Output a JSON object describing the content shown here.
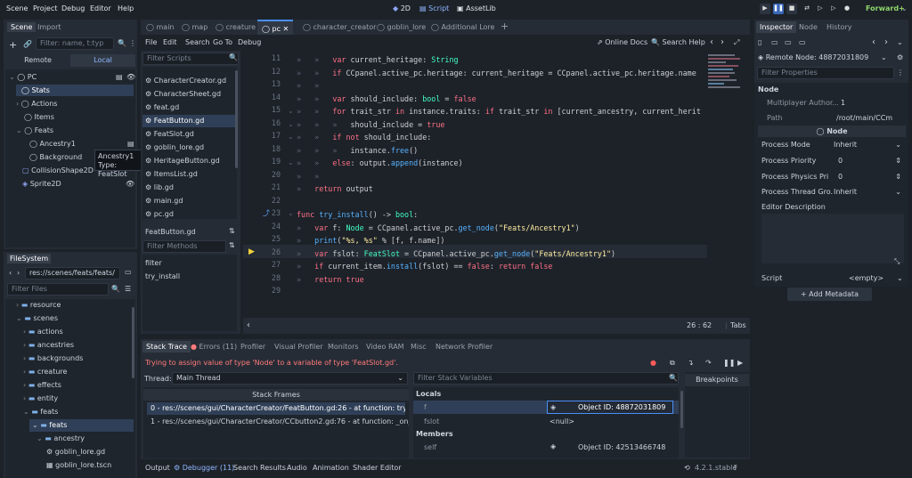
{
  "menu": {
    "items": [
      "Scene",
      "Project",
      "Debug",
      "Editor",
      "Help"
    ],
    "workspaces": [
      "2D",
      "Script",
      "AssetLib"
    ],
    "renderer": "Forward+"
  },
  "scene_panel": {
    "tabs": [
      "Scene",
      "Import"
    ],
    "filter_placeholder": "Filter: name, t:typ",
    "remote": "Remote",
    "local": "Local",
    "tree": [
      "PC",
      "Stats",
      "Actions",
      "Items",
      "Feats",
      "Ancestry1",
      "Background",
      "CollisionShape2D",
      "Sprite2D"
    ],
    "tooltip_line1": "Ancestry1",
    "tooltip_line2": "Type: FeatSlot"
  },
  "filesystem": {
    "title": "FileSystem",
    "path": "res://scenes/feats/feats/",
    "filter": "Filter Files",
    "items": [
      "resource",
      "scenes",
      "actions",
      "ancestries",
      "backgrounds",
      "creature",
      "effects",
      "entity",
      "feats",
      "feats",
      "ancestry",
      "goblin_lore.gd",
      "goblin_lore.tscn"
    ]
  },
  "script_tabs": [
    "main",
    "map",
    "creature",
    "pc",
    "character_creator",
    "goblin_lore",
    "Additional Lore"
  ],
  "script_menu": {
    "items": [
      "File",
      "Edit",
      "Search",
      "Go To",
      "Debug"
    ],
    "online_docs": "Online Docs",
    "search_help": "Search Help"
  },
  "script_list": {
    "filter": "Filter Scripts",
    "items": [
      "CharacterCreator.gd",
      "CharacterSheet.gd",
      "feat.gd",
      "FeatButton.gd",
      "FeatSlot.gd",
      "goblin_lore.gd",
      "HeritageButton.gd",
      "ItemsList.gd",
      "lib.gd",
      "main.gd",
      "pc.gd"
    ],
    "current": "FeatButton.gd",
    "methods_filter": "Filter Methods",
    "methods": [
      "filter",
      "try_install"
    ]
  },
  "editor": {
    "lines": [
      "11",
      "12",
      "13",
      "14",
      "15",
      "16",
      "17",
      "18",
      "19",
      "20",
      "21",
      "22",
      "23",
      "24",
      "25",
      "26",
      "27",
      "28",
      "29"
    ],
    "cursor": "26 :   62",
    "indent": "Tabs",
    "code": {
      "l11a": "var",
      "l11b": " current_heritage: ",
      "l11c": "String",
      "l12a": "if",
      "l12b": " CCpanel.active_pc.heritage: current_heritage = CCpanel.active_pc.heritage.name",
      "l14a": "var",
      "l14b": " should_include: ",
      "l14c": "bool",
      "l14d": " = ",
      "l14e": "false",
      "l15a": "for",
      "l15b": " trait_str ",
      "l15c": "in",
      "l15d": " instance.traits: ",
      "l15e": "if",
      "l15f": " trait_str ",
      "l15g": "in",
      "l15h": " [current_ancestry, current_herit",
      "l16a": "should_include = ",
      "l16b": "true",
      "l17a": "if",
      "l17b": " ",
      "l17c": "not",
      "l17d": " should_include:",
      "l18a": "instance.",
      "l18b": "free",
      "l18c": "()",
      "l19a": "else",
      ": ": "",
      "l19b": ": output.",
      "l19c": "append",
      "l19d": "(instance)",
      "l21a": "return",
      "l21b": " output",
      "l23a": "func",
      "l23b": " ",
      "l23c": "try_install",
      "l23d": "() -> ",
      "l23e": "bool",
      ":": ":",
      "l24a": "var",
      "l24b": " f: ",
      "l24c": "Node",
      "l24d": " = CCpanel.active_pc.",
      "l24e": "get_node",
      "l24f": "(",
      "l24g": "\"Feats/Ancestry1\"",
      "l24h": ")",
      "l25a": "print",
      "l25b": "(",
      "l25c": "\"%s, %s\"",
      "l25d": " % [f, f.name])",
      "l26a": "var",
      "l26b": " fslot: ",
      "l26c": "FeatSlot",
      "l26d": " = CCpanel.active_pc.",
      "l26e": "get_node",
      "l26f": "(",
      "l26g": "\"Feats/Ancestry1\"",
      "l26h": ")",
      "l27a": "if",
      "l27b": " current_item.",
      "l27c": "install",
      "l27d": "(fslot) == ",
      "l27e": "false",
      ": return ": ": ",
      "l27f": "return",
      "l27g": " ",
      "l27h": "false",
      "l28a": "return",
      "l28b": " ",
      "l28c": "true"
    }
  },
  "debugger": {
    "tabs": [
      "Stack Trace",
      "Errors (11)",
      "Profiler",
      "Visual Profiler",
      "Monitors",
      "Video RAM",
      "Misc",
      "Network Profiler"
    ],
    "error": "Trying to assign value of type 'Node' to a variable of type 'FeatSlot.gd'.",
    "thread_label": "Thread:",
    "thread_value": "Main Thread",
    "stack_header": "Stack Frames",
    "frames": [
      "0 - res://scenes/gui/CharacterCreator/FeatButton.gd:26 - at function: try_install",
      "1 - res://scenes/gui/CharacterCreator/CCbutton2.gd:76 - at function: _on_confirm"
    ],
    "filter_vars": "Filter Stack Variables",
    "locals": "Locals",
    "members": "Members",
    "vars": [
      {
        "name": "f",
        "value": "Object ID: 48872031809"
      },
      {
        "name": "fslot",
        "value": "<null>"
      },
      {
        "name": "self",
        "value": "Object ID: 42513466748"
      }
    ],
    "breakpoints": "Breakpoints"
  },
  "bottom_tabs": [
    "Output",
    "Debugger (11)",
    "Search Results",
    "Audio",
    "Animation",
    "Shader Editor"
  ],
  "version": "4.2.1.stable",
  "inspector": {
    "tabs": [
      "Inspector",
      "Node",
      "History"
    ],
    "remote_node": "Remote Node: 48872031809",
    "filter": "Filter Properties",
    "section": "Node",
    "props": [
      {
        "name": "Multiplayer Author...",
        "value": "1"
      },
      {
        "name": "Path",
        "value": "/root/main/CCm"
      }
    ],
    "node_header": "Node",
    "props2": [
      {
        "name": "Process Mode",
        "value": "Inherit"
      },
      {
        "name": "Process Priority",
        "value": "0"
      },
      {
        "name": "Process Physics Pri...",
        "value": "0"
      },
      {
        "name": "Process Thread Gro...",
        "value": "Inherit"
      },
      {
        "name": "Editor Description",
        "value": ""
      }
    ],
    "script_label": "Script",
    "script_value": "<empty>",
    "add_metadata": "Add Metadata"
  },
  "colors": {
    "accent": "#4a8ff7",
    "bg": "#1d2229",
    "panel": "#262c35",
    "error_text": "#ff7b7b",
    "keyword": "#ff7085",
    "type": "#42ffc2",
    "string": "#ffeda1"
  }
}
